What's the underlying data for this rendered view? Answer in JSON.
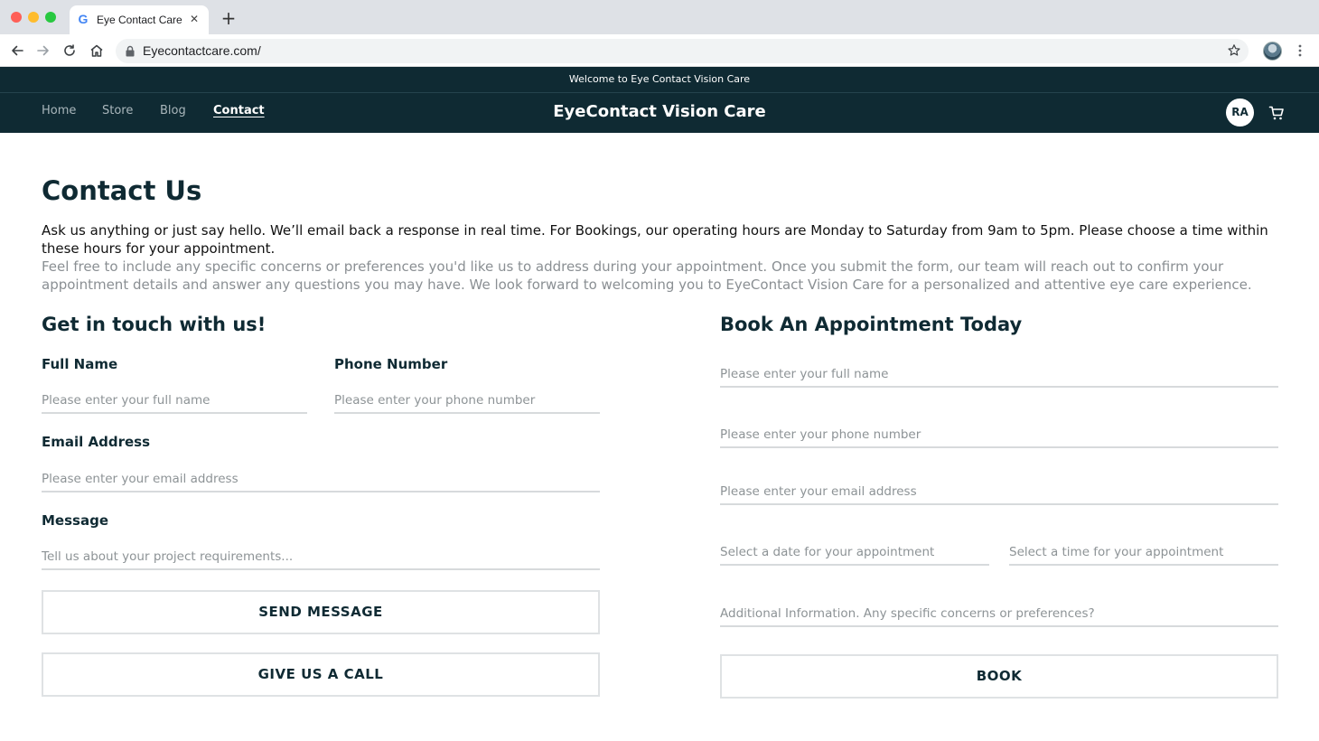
{
  "browser": {
    "tab_title": "Eye Contact Care",
    "url": "Eyecontactcare.com/",
    "icons": [
      "google-favicon",
      "close-icon",
      "plus-icon",
      "back-icon",
      "forward-icon",
      "reload-icon",
      "home-icon",
      "lock-icon",
      "star-icon",
      "kebab-menu-icon"
    ]
  },
  "site": {
    "announcement": "Welcome to Eye Contact Vision Care",
    "brand": "EyeContact Vision Care",
    "nav": [
      {
        "label": "Home",
        "active": false
      },
      {
        "label": "Store",
        "active": false
      },
      {
        "label": "Blog",
        "active": false
      },
      {
        "label": "Contact",
        "active": true
      }
    ],
    "user_initials": "RA",
    "colors": {
      "header_bg": "#0f2a33",
      "text_dark": "#0f2a33",
      "muted": "#8a8f93"
    }
  },
  "content": {
    "title": "Contact Us",
    "intro": "Ask us anything or just say hello. We’ll email back a response in real time. For Bookings, our operating hours are Monday to Saturday from  9am to 5pm. Please choose a time within these hours for your appointment.",
    "intro_sub": "Feel free to include any specific concerns or preferences you'd like us to address during your appointment. Once you submit the form, our team will reach out to confirm your appointment details and answer any questions you may have. We look forward to welcoming you to EyeContact Vision Care for a personalized and attentive eye care experience."
  },
  "contact_form": {
    "title": "Get in touch with us!",
    "full_name_label": "Full Name",
    "full_name_placeholder": "Please enter your full name",
    "phone_label": "Phone Number",
    "phone_placeholder": "Please enter your phone number",
    "email_label": "Email Address",
    "email_placeholder": "Please enter your email address",
    "message_label": "Message",
    "message_placeholder": "Tell us about your project requirements...",
    "send_button": "SEND MESSAGE",
    "call_button": "GIVE US A CALL"
  },
  "booking_form": {
    "title": "Book An Appointment Today",
    "name_placeholder": "Please enter your full name",
    "phone_placeholder": "Please enter your phone number",
    "email_placeholder": "Please enter your email address",
    "date_placeholder": "Select a date for your appointment",
    "time_placeholder": "Select a time for your appointment",
    "info_placeholder": "Additional Information. Any specific concerns or preferences?",
    "book_button": "BOOK"
  }
}
